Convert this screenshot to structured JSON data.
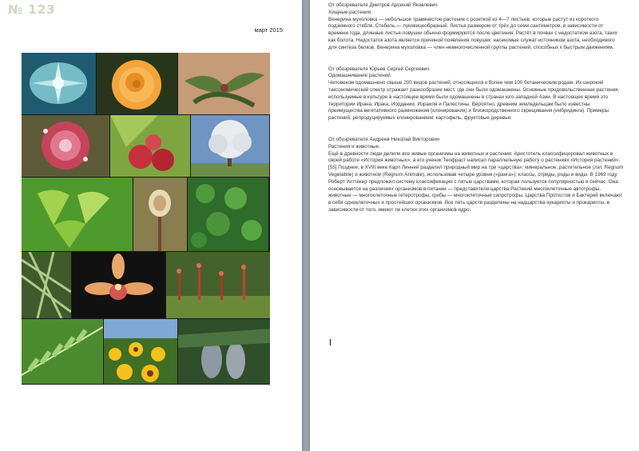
{
  "page1": {
    "issue_number": "№ 123",
    "date": "март 2015",
    "gallery": [
      "diatom-plant-photo",
      "orange-rose-photo",
      "welwitschia-photo",
      "sundew-photo",
      "raspberry-photo",
      "blossoming-tree-photo",
      "ginkgo-leaves-photo",
      "fern-fiddlehead-photo",
      "clover-groundcover-photo",
      "palm-fronds-photo",
      "orchid-photo",
      "red-sprouts-photo",
      "fern-leaves-photo",
      "sunflowers-photo",
      "fir-cones-photo"
    ]
  },
  "page2": {
    "sections": [
      {
        "author": "От обозревателя Дмитров Арсений Яковлевич",
        "title": "Хищные растения.",
        "body": "Венерина мухоловка — небольшое травянистое растение с розеткой из 4—7 листьев, которые растут из короткого подземного стебля. Стебель — луковицеобразный. Листья размером от трёх до семи сантиметров, в зависимости от времени года, длинные листья-ловушки обычно формируются после цветения. Растёт в почвах с недостатком азота, таких как болота. Недостаток азота является причиной появления ловушек: насекомые служат источником азота, необходимого для синтеза белков. Венерина мухоловка — член немногочисленной группы растений, способных к быстрым движениям."
      },
      {
        "author": "От обозревателя Юрьев Сергей Сергеевич",
        "title": "Одомашнивание растений.",
        "body": "Человеком одомашнено свыше 200 видов растений, относящихся к более чем 100 ботаническим родам. Их широкий таксономический спектр отражает разнообразие мест, где они были одомашнены. Основные продовольственные растения, используемые в культуре в настоящее время были одомашнены в странах юго-западной Азии. В настоящее время это территории Ирана, Ирака, Иордании, Израиля и Палестины. Вероятно, древним земледельцам было известны преимущества вегетативного размножения (клонирования) и близкородственного скрещивания (инбридинга). Примеры растений, репродуцируемых клонированием: картофель, фруктовые деревья."
      },
      {
        "author": "От обозревателя Андреев Николай Викторович",
        "title": "Растения и животные.",
        "body": "Ещё в древности люди делили все живые организмы на животных и растения. Аристотель классифицировал животных в своей работе «История животных», а его ученик Теофраст написал параллельную работу о растениях «История растений».[55] Позднее, в XVIII веке Карл Линней разделил природный мир на три «царства»: минеральное, растительное (лат. Regnum Vegetabile) и животное (Regnum Animale), использовав четыре уровня («ранга»): классы, отряды, роды и виды. В 1969 году Роберт Уиттекер предложил систему классификации с пятью царствами, которая пользуется популярностью и сейчас. Она основывается на различиях организмов в питании — представители царства Растений многоклеточные автотрофы, животные — многоклеточные гетеротрофы, грибы — многоклеточные сапротрофы. Царства Протистов и Бактерий включают в себя одноклеточных и простейших организмов. Все пять царств разделены на надцарства эукариоты и прокариоты, в зависимости от того, имеют ли клетки этих организмов ядро."
      }
    ]
  }
}
